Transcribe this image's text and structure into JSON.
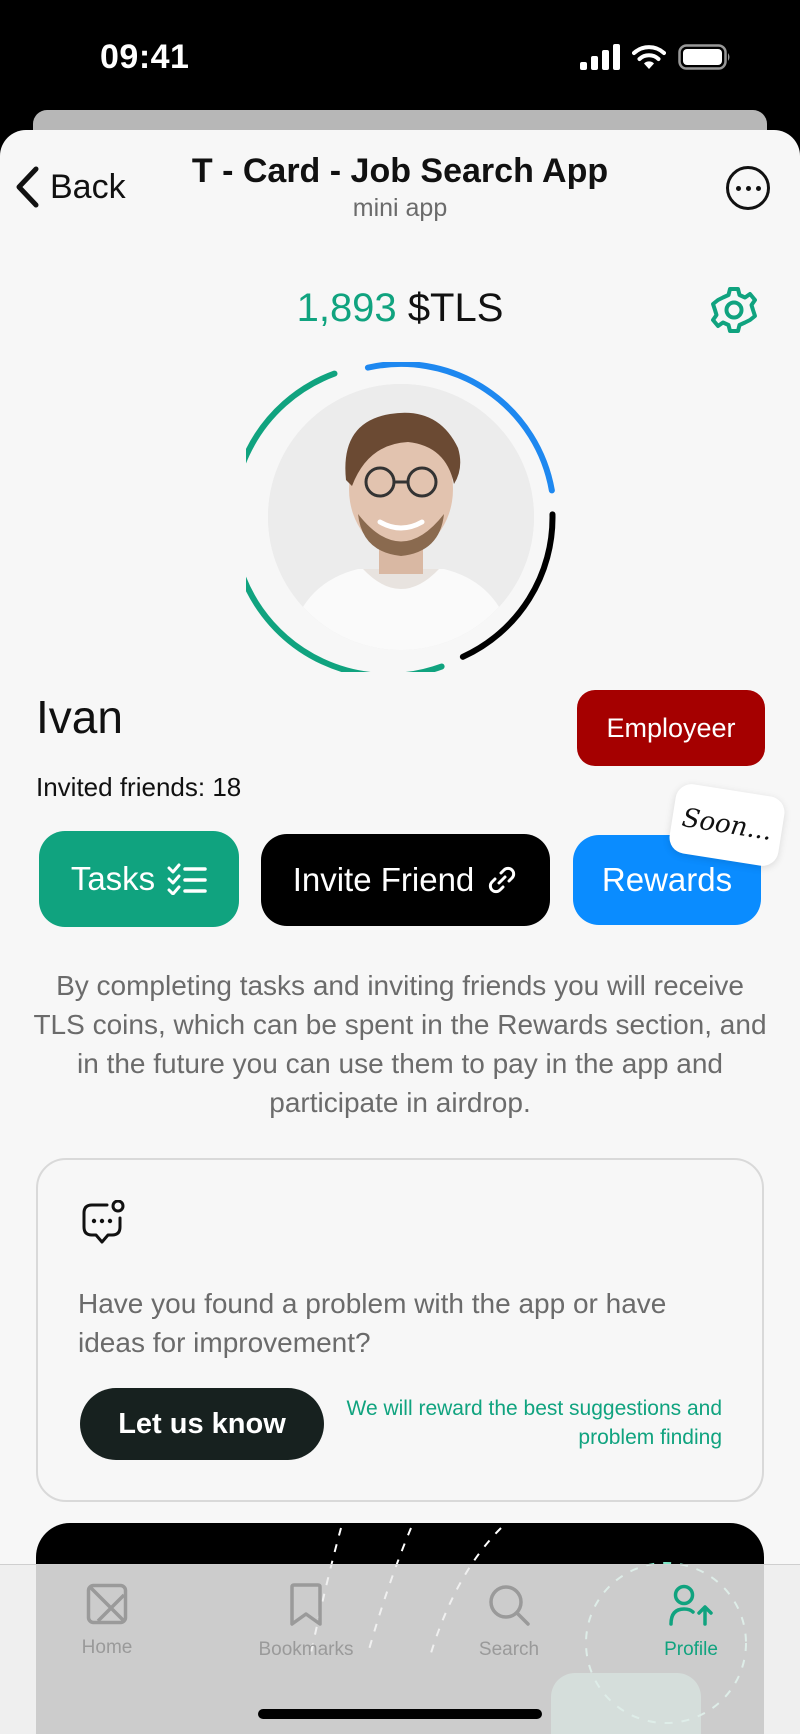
{
  "status_bar": {
    "time": "09:41"
  },
  "header": {
    "back_label": "Back",
    "title": "T - Card - Job Search App",
    "subtitle": "mini app"
  },
  "balance": {
    "amount": "1,893",
    "currency": "$TLS"
  },
  "profile": {
    "name": "Ivan",
    "role": "Employeer",
    "invited_text": "Invited friends: 18"
  },
  "actions": {
    "tasks": "Tasks",
    "invite": "Invite Friend",
    "rewards": "Rewards",
    "soon": "Soon..."
  },
  "description": "By completing tasks and inviting friends you will receive TLS coins, which can be spent in the Rewards section, and in the future you can use them to pay in the app and participate in airdrop.",
  "feedback": {
    "text": "Have you found a problem with the app or have ideas for improvement?",
    "button": "Let us know",
    "note": "We will reward the best suggestions and problem finding"
  },
  "tabs": [
    {
      "label": "Home",
      "icon": "home-icon",
      "active": false
    },
    {
      "label": "Bookmarks",
      "icon": "bookmark-icon",
      "active": false
    },
    {
      "label": "Search",
      "icon": "search-icon",
      "active": false
    },
    {
      "label": "Profile",
      "icon": "profile-icon",
      "active": true
    }
  ],
  "colors": {
    "accent_green": "#10a37f",
    "accent_blue": "#0a8cff",
    "badge_red": "#a50000"
  }
}
